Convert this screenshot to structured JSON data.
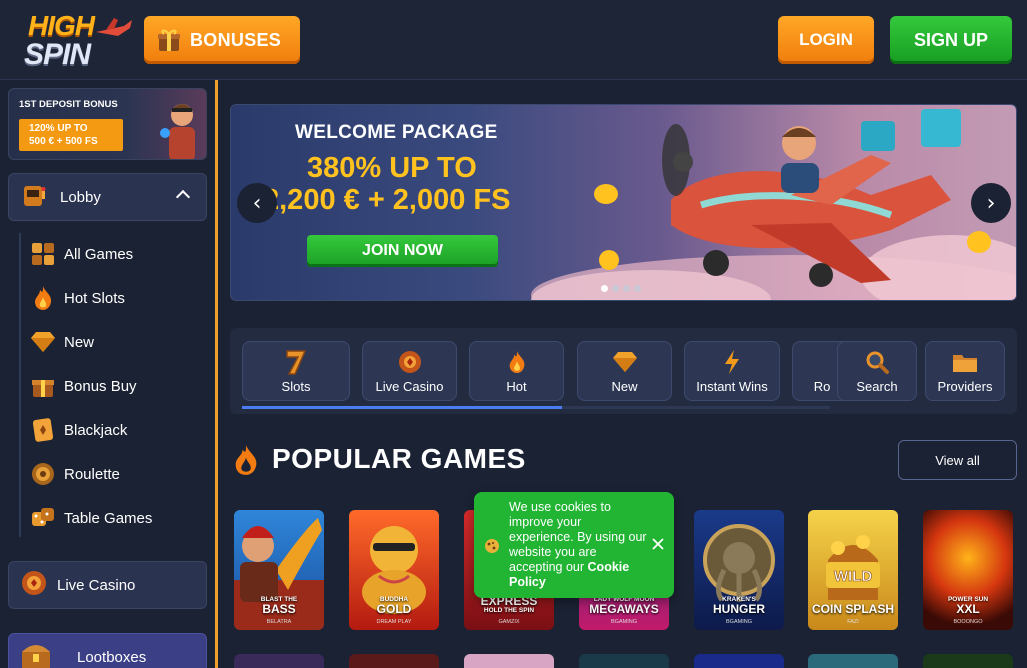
{
  "header": {
    "logo_top": "HIGH",
    "logo_bottom": "SPIN",
    "bonuses_label": "BONUSES",
    "login_label": "LOGIN",
    "signup_label": "SIGN UP"
  },
  "sidebar": {
    "promo": {
      "title": "1ST DEPOSIT BONUS",
      "line1": "120% UP TO",
      "line2": "500 € + 500 FS"
    },
    "lobby_label": "Lobby",
    "items": [
      {
        "label": "All Games",
        "icon": "all-games-icon"
      },
      {
        "label": "Hot Slots",
        "icon": "flame-icon"
      },
      {
        "label": "New",
        "icon": "diamond-icon"
      },
      {
        "label": "Bonus Buy",
        "icon": "gift-box-icon"
      },
      {
        "label": "Blackjack",
        "icon": "card-icon"
      },
      {
        "label": "Roulette",
        "icon": "roulette-icon"
      },
      {
        "label": "Table Games",
        "icon": "dice-icon"
      }
    ],
    "live_casino_label": "Live Casino",
    "lootboxes_label": "Lootboxes"
  },
  "banner": {
    "subtitle": "WELCOME PACKAGE",
    "headline1": "380% UP TO",
    "headline2": "2,200 € + 2,000 FS",
    "cta": "JOIN NOW",
    "prev": "‹",
    "next": "›",
    "slides": 4,
    "active_slide": 1
  },
  "categories": [
    {
      "label": "Slots",
      "icon": "seven-icon"
    },
    {
      "label": "Live Casino",
      "icon": "chip-icon"
    },
    {
      "label": "Hot",
      "icon": "flame-icon"
    },
    {
      "label": "New",
      "icon": "diamond-icon"
    },
    {
      "label": "Instant Wins",
      "icon": "lightning-icon"
    },
    {
      "label": "Ro",
      "icon": "roulette-icon"
    },
    {
      "label": "Search",
      "icon": "search-icon"
    },
    {
      "label": "Providers",
      "icon": "folder-icon"
    }
  ],
  "popular": {
    "title": "POPULAR GAMES",
    "view_all": "View all",
    "games": [
      {
        "pre": "BLAST THE",
        "name": "BASS",
        "provider": "BELATRA"
      },
      {
        "pre": "BUDDHA",
        "name": "GOLD",
        "provider": "DREAM PLAY"
      },
      {
        "pre": "",
        "name": "EXPRESS",
        "sub": "HOLD THE SPIN",
        "provider": "GAMZIX"
      },
      {
        "pre": "LADY WOLF MOON",
        "name": "MEGAWAYS",
        "provider": "BGAMING"
      },
      {
        "pre": "KRAKEN'S",
        "name": "HUNGER",
        "provider": "BGAMING"
      },
      {
        "pre": "",
        "name": "COIN SPLASH",
        "provider": "FAZI"
      },
      {
        "pre": "POWER SUN",
        "name": "XXL",
        "provider": "BOOONGO"
      }
    ]
  },
  "cookie": {
    "text": "We use cookies to improve your experience. By using our website you are accepting our ",
    "link": "Cookie Policy"
  }
}
